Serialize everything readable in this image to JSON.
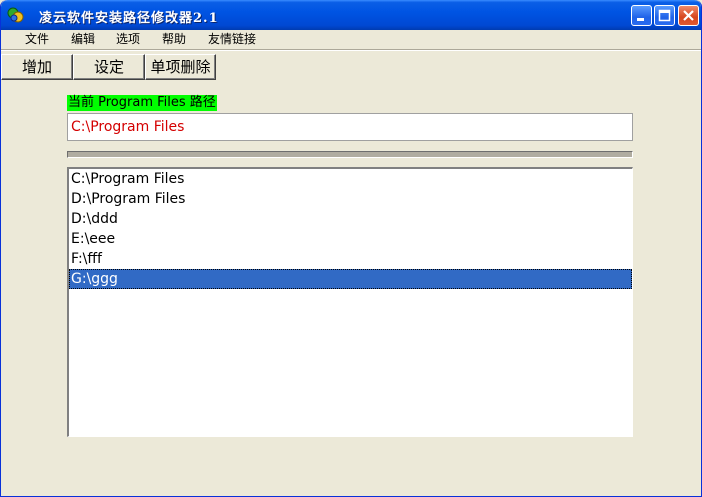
{
  "window": {
    "title": "凌云软件安装路径修改器2.1",
    "icon": "app-icon"
  },
  "menu": [
    "文件",
    "编辑",
    "选项",
    "帮助",
    "友情链接"
  ],
  "toolbar": {
    "add_label": "增加",
    "set_label": "设定",
    "delete_label": "单项删除"
  },
  "current_path": {
    "label": "当前 Program Files 路径",
    "value": "C:\\Program Files"
  },
  "progress": {
    "fraction": 0
  },
  "paths": [
    "C:\\Program Files",
    "D:\\Program Files",
    "D:\\ddd",
    "E:\\eee",
    "F:\\fff",
    "G:\\ggg"
  ],
  "selected_index": 5,
  "colors": {
    "titlebar": "#0054e3",
    "label_highlight": "#00ff00",
    "path_text": "#d40000",
    "selection": "#316ac5"
  }
}
